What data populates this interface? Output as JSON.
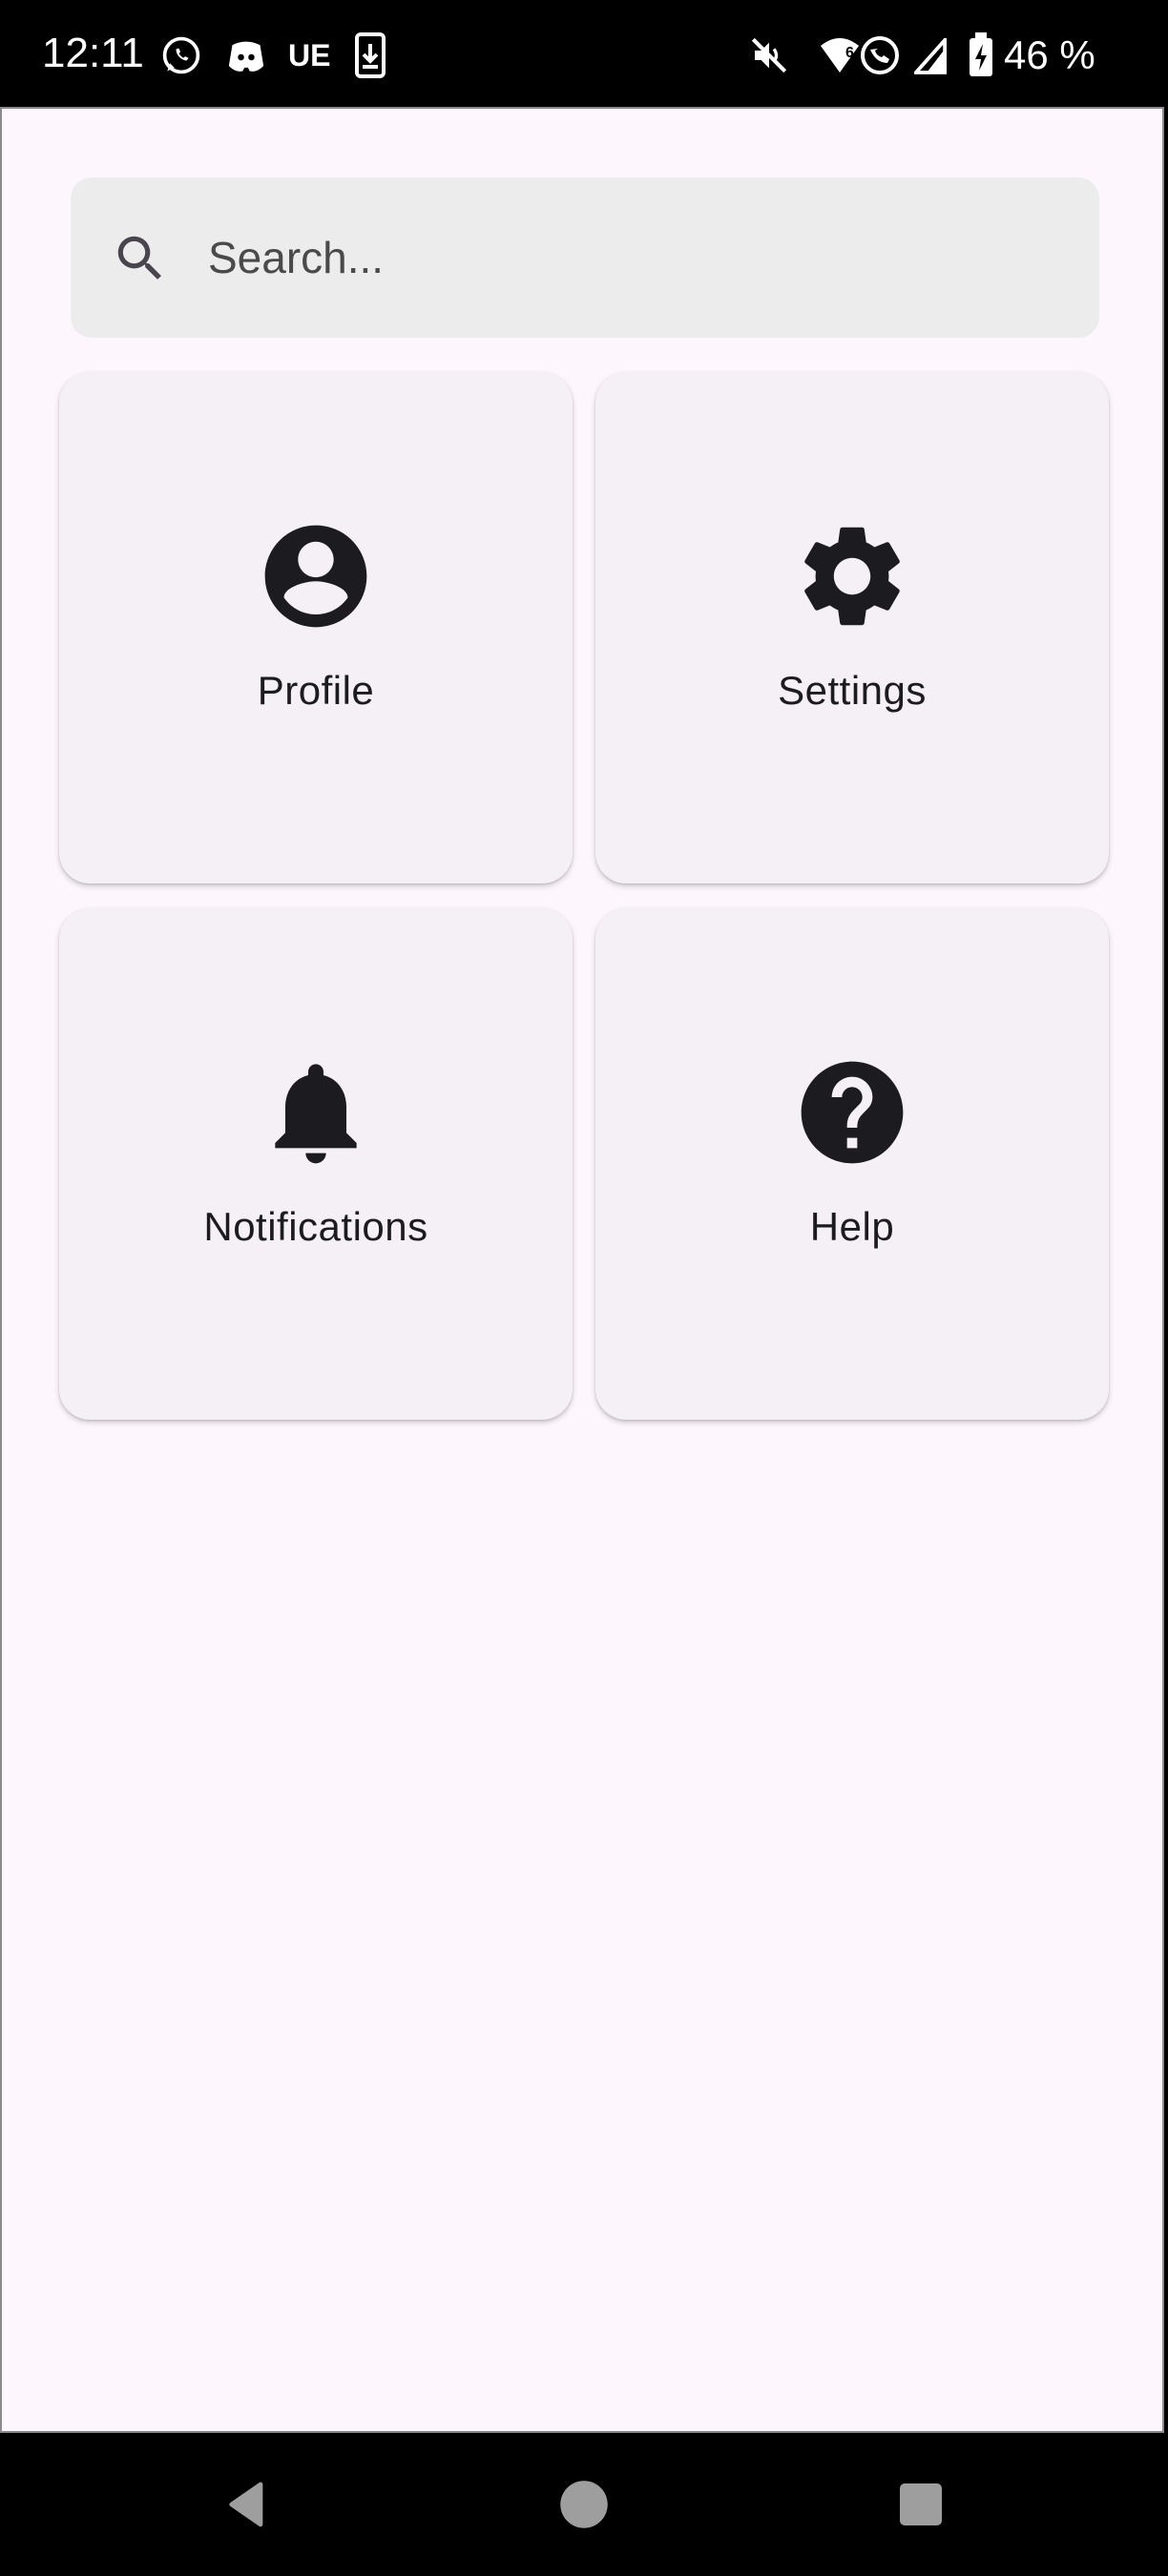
{
  "status_bar": {
    "time": "12:11",
    "network_label": "UE",
    "battery_percent": "46 %",
    "icons": [
      "whatsapp-icon",
      "discord-icon",
      "download-icon",
      "mute-icon",
      "wifi-icon",
      "signal-icon",
      "battery-icon"
    ]
  },
  "search": {
    "placeholder": "Search...",
    "value": ""
  },
  "cards": [
    {
      "label": "Profile",
      "icon": "account-circle-icon"
    },
    {
      "label": "Settings",
      "icon": "settings-gear-icon"
    },
    {
      "label": "Notifications",
      "icon": "notifications-bell-icon"
    },
    {
      "label": "Help",
      "icon": "help-icon"
    }
  ],
  "nav_bar": {
    "buttons": [
      "back-icon",
      "home-icon",
      "recents-icon"
    ]
  },
  "colors": {
    "background": "#fdf7fd",
    "card": "#f4f0f6",
    "search_field": "#ececec",
    "text": "#1c1b1f",
    "icon": "#1c1b1f"
  }
}
